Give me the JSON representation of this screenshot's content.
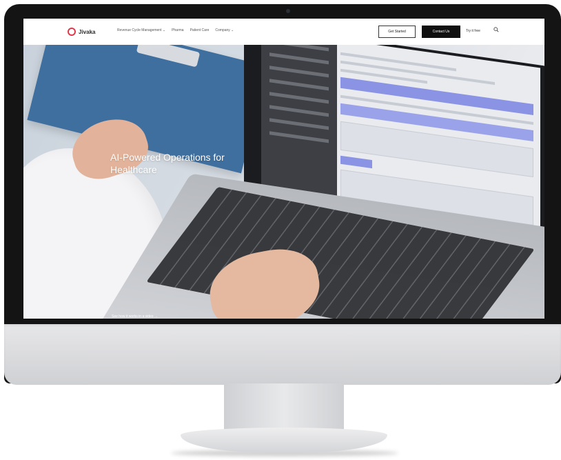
{
  "brand": {
    "name": "Jivaka"
  },
  "nav": {
    "items": [
      "Revenue Cycle Management ⌄",
      "Pharma",
      "Patient Care",
      "Company ⌄"
    ],
    "cta_outline": "Get Started",
    "cta_dark": "Contact Us",
    "language": "Try it free",
    "search_icon": "search-icon"
  },
  "hero": {
    "title": "AI-Powered Operations for Healthcare",
    "link": "See how it works in a video"
  },
  "colors": {
    "brand_accent": "#e0394d",
    "nav_dark_button": "#101010",
    "hero_text": "#ffffff"
  }
}
